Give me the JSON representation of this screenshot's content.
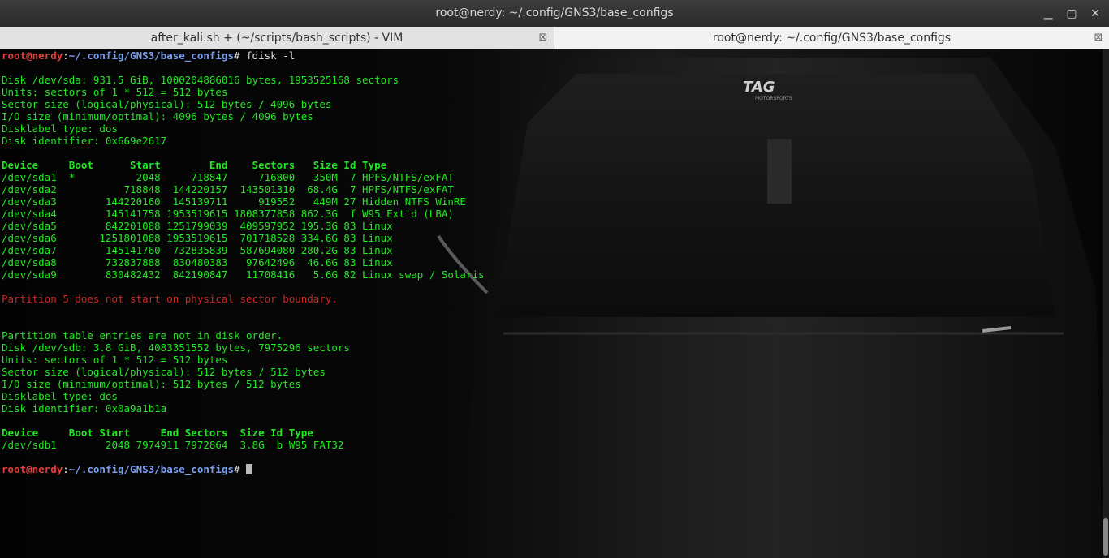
{
  "window": {
    "title": "root@nerdy: ~/.config/GNS3/base_configs",
    "min_label": "▁",
    "max_label": "▢",
    "close_label": "✕"
  },
  "tabs": [
    {
      "label": "after_kali.sh + (~/scripts/bash_scripts) - VIM",
      "close": "⊠"
    },
    {
      "label": "root@nerdy: ~/.config/GNS3/base_configs",
      "close": "⊠"
    }
  ],
  "prompt": {
    "user": "root@nerdy",
    "sep": ":",
    "path": "~/.config/GNS3/base_configs",
    "symbol": "# "
  },
  "command": "fdisk -l",
  "sda": {
    "disk": "Disk /dev/sda: 931.5 GiB, 1000204886016 bytes, 1953525168 sectors",
    "units": "Units: sectors of 1 * 512 = 512 bytes",
    "sector_size": "Sector size (logical/physical): 512 bytes / 4096 bytes",
    "io_size": "I/O size (minimum/optimal): 4096 bytes / 4096 bytes",
    "label_type": "Disklabel type: dos",
    "identifier": "Disk identifier: 0x669e2617",
    "header": "Device     Boot      Start        End    Sectors   Size Id Type",
    "rows": [
      "/dev/sda1  *          2048     718847     716800   350M  7 HPFS/NTFS/exFAT",
      "/dev/sda2           718848  144220157  143501310  68.4G  7 HPFS/NTFS/exFAT",
      "/dev/sda3        144220160  145139711     919552   449M 27 Hidden NTFS WinRE",
      "/dev/sda4        145141758 1953519615 1808377858 862.3G  f W95 Ext'd (LBA)",
      "/dev/sda5        842201088 1251799039  409597952 195.3G 83 Linux",
      "/dev/sda6       1251801088 1953519615  701718528 334.6G 83 Linux",
      "/dev/sda7        145141760  732835839  587694080 280.2G 83 Linux",
      "/dev/sda8        732837888  830480383   97642496  46.6G 83 Linux",
      "/dev/sda9        830482432  842190847   11708416   5.6G 82 Linux swap / Solaris"
    ],
    "warning": "Partition 5 does not start on physical sector boundary.",
    "order_note": "Partition table entries are not in disk order."
  },
  "sdb": {
    "disk": "Disk /dev/sdb: 3.8 GiB, 4083351552 bytes, 7975296 sectors",
    "units": "Units: sectors of 1 * 512 = 512 bytes",
    "sector_size": "Sector size (logical/physical): 512 bytes / 512 bytes",
    "io_size": "I/O size (minimum/optimal): 512 bytes / 512 bytes",
    "label_type": "Disklabel type: dos",
    "identifier": "Disk identifier: 0x0a9a1b1a",
    "header": "Device     Boot Start     End Sectors  Size Id Type",
    "rows": [
      "/dev/sdb1        2048 7974911 7972864  3.8G  b W95 FAT32"
    ]
  },
  "wallpaper": {
    "logo_text": "TAG",
    "sub_text": "MOTORSPORTS"
  }
}
